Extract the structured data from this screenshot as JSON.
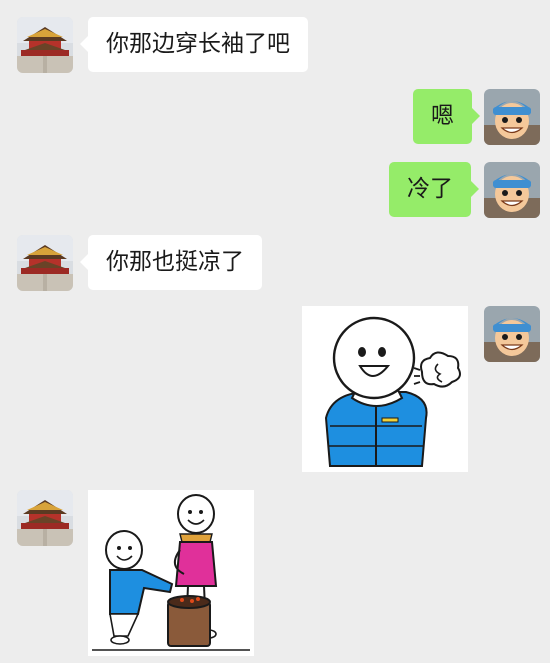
{
  "messages": [
    {
      "side": "left",
      "type": "text",
      "text": "你那边穿长袖了吧"
    },
    {
      "side": "right",
      "type": "text",
      "text": "嗯"
    },
    {
      "side": "right",
      "type": "text",
      "text": "冷了"
    },
    {
      "side": "left",
      "type": "text",
      "text": "你那也挺凉了"
    },
    {
      "side": "right",
      "type": "sticker",
      "sticker": "person-in-blue-puffer-jacket-sighing-sticker"
    },
    {
      "side": "left",
      "type": "sticker",
      "sticker": "two-people-warming-by-fire-bucket-sticker"
    }
  ],
  "avatars": {
    "contact": "palace-avatar",
    "self": "cartoon-boy-avatar"
  },
  "colors": {
    "background": "#ededed",
    "incoming_bubble": "#ffffff",
    "outgoing_bubble": "#95ec69",
    "text": "#1a1a1a",
    "jacket_blue": "#1e8fe0",
    "jacket_pink": "#e0309a",
    "palace_red": "#b5322a"
  }
}
